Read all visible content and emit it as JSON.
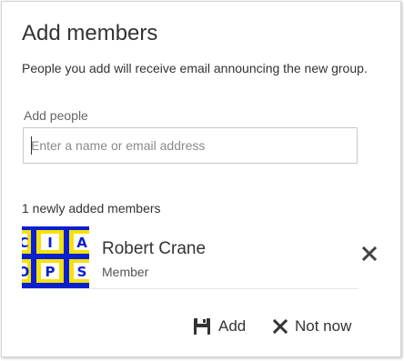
{
  "dialog": {
    "title": "Add members",
    "description": "People you add will receive email announcing the new group."
  },
  "add_people": {
    "label": "Add people",
    "placeholder": "Enter a name or email address",
    "value": ""
  },
  "added": {
    "count_text": "1 newly added members",
    "members": [
      {
        "name": "Robert Crane",
        "role": "Member",
        "avatar_letters": [
          "C",
          "I",
          "A",
          "O",
          "P",
          "S"
        ],
        "avatar_colors": {
          "background": "#0a1fd0",
          "tile": "#f5e10a",
          "tile_dark": "#0a1fd0",
          "tile_white": "#ffffff"
        }
      }
    ]
  },
  "actions": {
    "add_label": "Add",
    "not_now_label": "Not now",
    "add_icon": "save-icon",
    "not_now_icon": "close-icon",
    "remove_icon": "close-icon"
  }
}
